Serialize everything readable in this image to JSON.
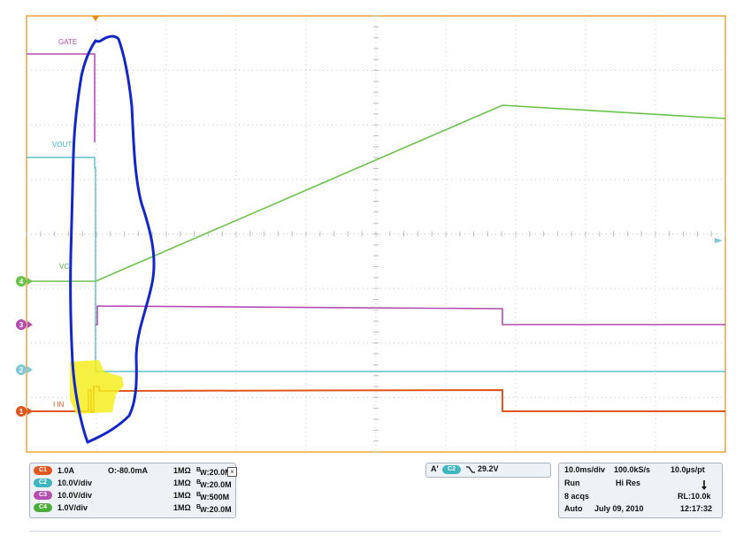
{
  "waveforms": {
    "labels": {
      "gate": "GATE",
      "vout": "VOUT",
      "vc": "VC",
      "iin": "I IN"
    },
    "channel_markers": [
      "4",
      "3",
      "2",
      "1"
    ]
  },
  "vertical_panel": {
    "rows": [
      {
        "badge": "C1",
        "color": "#e0561e",
        "scale": "1.0A",
        "offset": "O:-80.0mA",
        "impedance": "1MΩ",
        "bw_label": "W",
        "bandwidth": ":20.0M"
      },
      {
        "badge": "C2",
        "color": "#3fb5c0",
        "scale": "10.0V/div",
        "offset": "",
        "impedance": "1MΩ",
        "bw_label": "W",
        "bandwidth": ":20.0M"
      },
      {
        "badge": "C3",
        "color": "#b24fb0",
        "scale": "10.0V/div",
        "offset": "",
        "impedance": "1MΩ",
        "bw_label": "W",
        "bandwidth": ":500M"
      },
      {
        "badge": "C4",
        "color": "#4eac3b",
        "scale": "1.0V/div",
        "offset": "",
        "impedance": "1MΩ",
        "bw_label": "W",
        "bandwidth": ":20.0M"
      }
    ],
    "bw_prefix": "B"
  },
  "trigger_panel": {
    "mode": "A'",
    "source": "C2",
    "slope_icon": "falling-edge-icon",
    "level": "29.2V"
  },
  "horizontal_panel": {
    "timebase": "10.0ms/div",
    "sample_rate": "100.0kS/s",
    "resolution": "10.0µs/pt",
    "state": "Run",
    "acq_mode": "Hi Res",
    "acqs": "8 acqs",
    "record_length": "RL:10.0k",
    "trigger_mode": "Auto",
    "date": "July 09, 2010",
    "time": "12:17:32"
  },
  "colors": {
    "graticule_border": "#f0a43a",
    "gate": "#b24fb0",
    "vout": "#3fb5c0",
    "vc": "#6cc24a",
    "iin": "#e0561e",
    "annotation_outline": "#1326c8",
    "annotation_highlight": "#f5ee1e"
  }
}
